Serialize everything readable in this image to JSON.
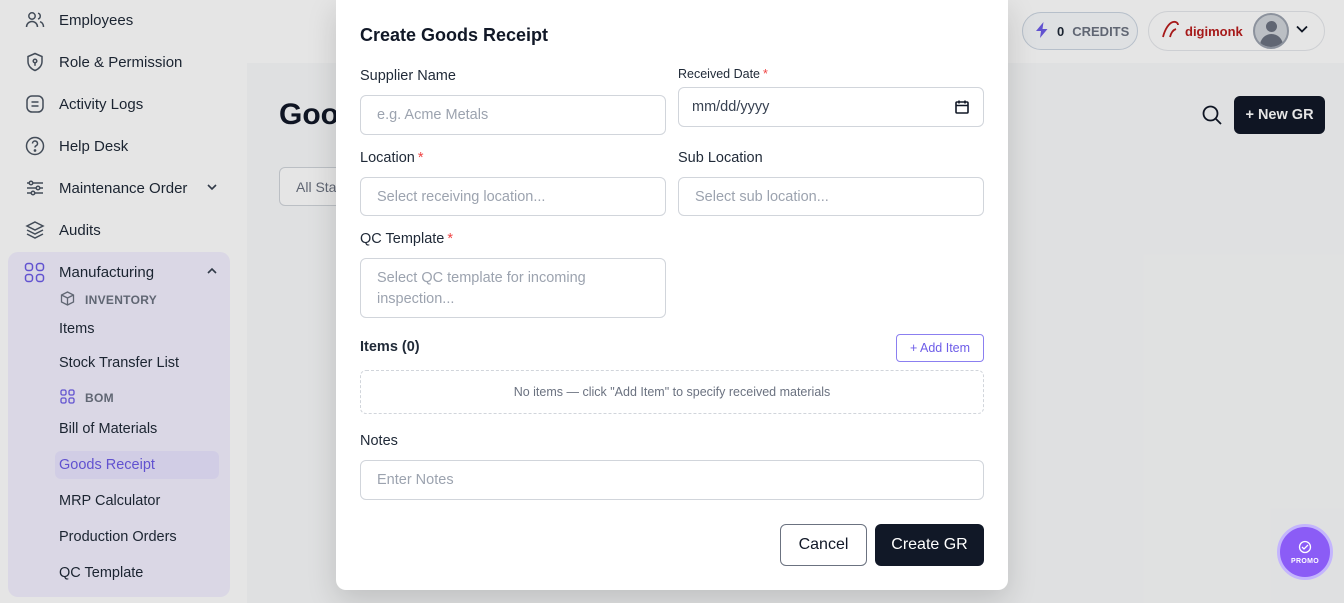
{
  "sidebar": {
    "items": [
      {
        "label": "Employees",
        "icon": "users-icon"
      },
      {
        "label": "Role & Permission",
        "icon": "shield-icon"
      },
      {
        "label": "Activity Logs",
        "icon": "log-icon"
      },
      {
        "label": "Help Desk",
        "icon": "help-icon"
      },
      {
        "label": "Maintenance Order",
        "icon": "sliders-icon"
      },
      {
        "label": "Audits",
        "icon": "layers-icon"
      },
      {
        "label": "Manufacturing",
        "icon": "grid-icon"
      }
    ],
    "inventory_heading": "INVENTORY",
    "inventory_items": [
      "Items",
      "Stock Transfer List"
    ],
    "bom_heading": "BOM",
    "bom_items": [
      "Bill of Materials",
      "Goods Receipt",
      "MRP Calculator",
      "Production Orders",
      "QC Template"
    ],
    "active_item": "Goods Receipt"
  },
  "header": {
    "credits_value": "0",
    "credits_label": "CREDITS",
    "brand": "digimonk"
  },
  "page": {
    "title": "Goo",
    "filter_value": "All Sta",
    "new_button": "+ New GR"
  },
  "modal": {
    "title": "Create Goods Receipt",
    "supplier": {
      "label": "Supplier Name",
      "placeholder": "e.g. Acme Metals"
    },
    "received_date": {
      "label": "Received Date",
      "required": "*",
      "value": "mm/dd/yyyy"
    },
    "location": {
      "label": "Location",
      "required": "*",
      "placeholder": "Select receiving location..."
    },
    "sub_location": {
      "label": "Sub Location",
      "placeholder": "Select sub location..."
    },
    "qc_template": {
      "label": "QC Template",
      "required": "*",
      "placeholder": "Select QC template for incoming inspection..."
    },
    "items": {
      "label": "Items (0)",
      "add_button": "+ Add Item",
      "empty_text": "No items — click \"Add Item\" to specify received materials"
    },
    "notes": {
      "label": "Notes",
      "placeholder": "Enter Notes"
    },
    "cancel_button": "Cancel",
    "create_button": "Create GR"
  },
  "promo": {
    "label": "PROMO"
  },
  "colors": {
    "accent": "#6d5ce8",
    "primary_dark": "#111827",
    "required": "#ef4444",
    "active_bg": "#e9e5ff"
  }
}
